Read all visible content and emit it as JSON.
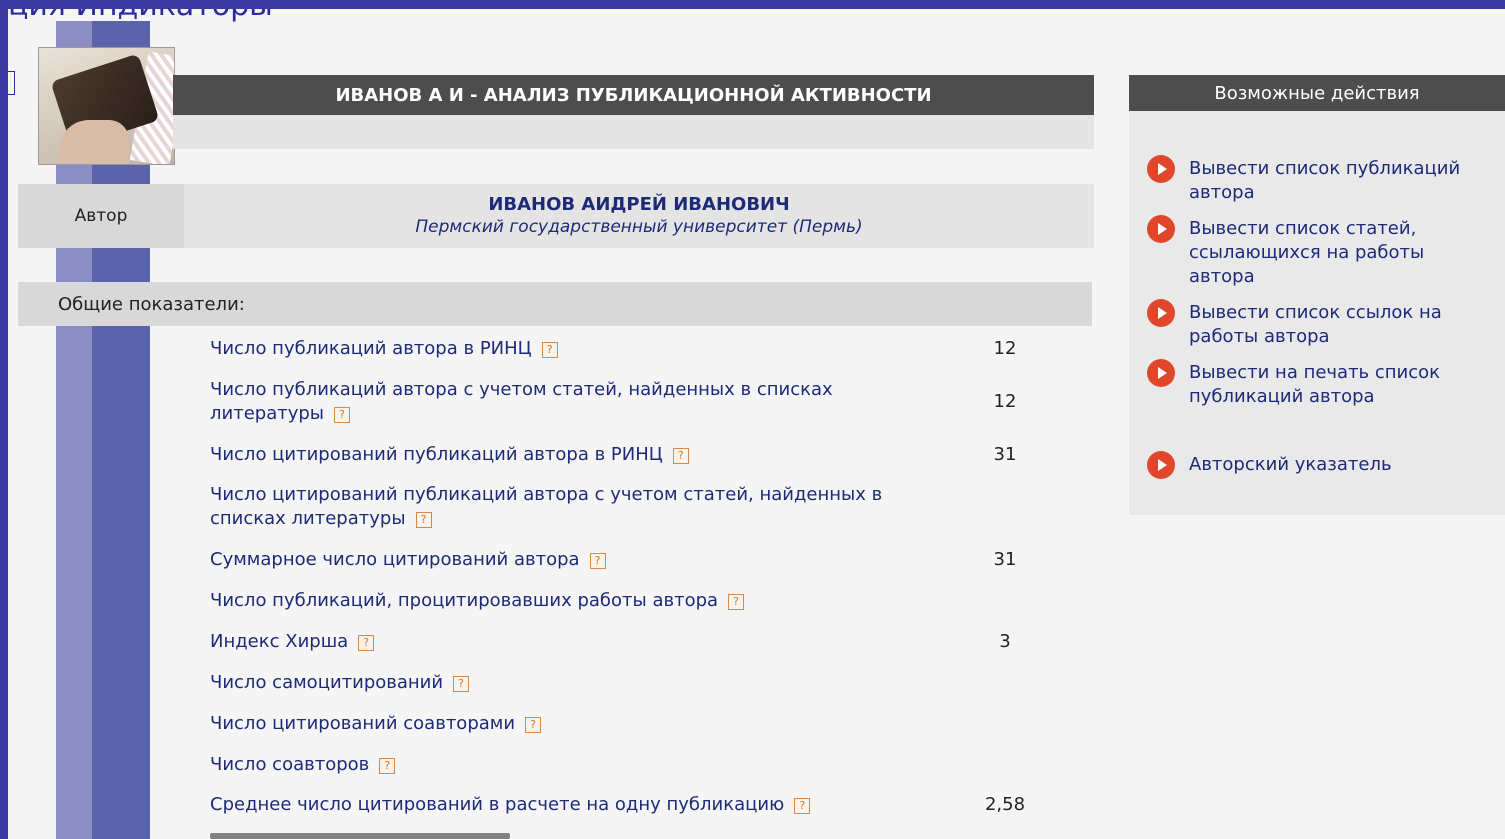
{
  "window": {
    "top_partial_text": "ция Индикаторы"
  },
  "header": {
    "title": "ИВАНОВ А И - АНАЛИЗ ПУБЛИКАЦИОННОЙ АКТИВНОСТИ",
    "photo_icon": "briefcase-photo"
  },
  "author": {
    "label": "Автор",
    "name": "ИВАНОВ АИДРЕЙ ИВАНОВИЧ",
    "organization": "Пермский государственный университет (Пермь)"
  },
  "section": {
    "title": "Общие показатели:"
  },
  "help_symbol": "?",
  "metrics": [
    {
      "label": "Число публикаций автора в РИНЦ",
      "value": "12"
    },
    {
      "label": "Число публикаций автора с учетом статей, найденных в списках литературы",
      "value": "12"
    },
    {
      "label": "Число цитирований публикаций автора в РИНЦ",
      "value": "31"
    },
    {
      "label": "Число цитирований публикаций автора с учетом статей, найденных в списках литературы",
      "value": ""
    },
    {
      "label": "Суммарное число цитирований автора",
      "value": "31"
    },
    {
      "label": "Число публикаций, процитировавших работы автора",
      "value": ""
    },
    {
      "label": "Индекс Хирша",
      "value": "3"
    },
    {
      "label": "Число самоцитирований",
      "value": ""
    },
    {
      "label": "Число цитирований соавторами",
      "value": ""
    },
    {
      "label": "Число соавторов",
      "value": ""
    },
    {
      "label": "Среднее число цитирований в расчете на одну публикацию",
      "value": "2,58"
    }
  ],
  "actions": {
    "title": "Возможные действия",
    "icon": "play-circle-icon",
    "items": [
      {
        "label": "Вывести список публикаций автора"
      },
      {
        "label": "Вывести список статей, ссылающихся на работы автора"
      },
      {
        "label": "Вывести список ссылок на работы автора"
      },
      {
        "label": "Вывести на печать список публикаций автора"
      },
      {
        "label": "Авторский указатель"
      }
    ]
  },
  "colors": {
    "outer_frame": "#3a3aa0",
    "header_bar": "#4d4d4d",
    "link_text": "#1d2a78",
    "action_icon": "#e0472a"
  }
}
